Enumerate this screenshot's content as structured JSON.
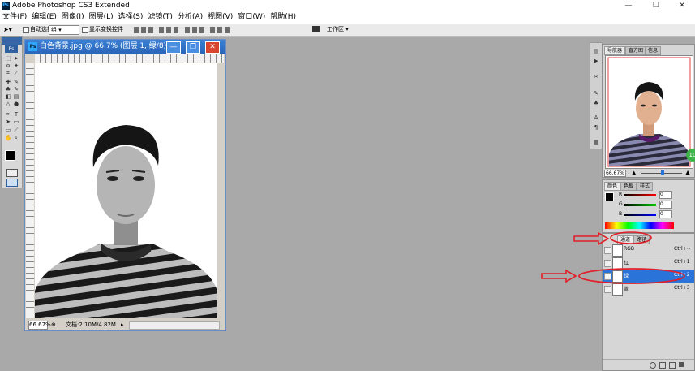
{
  "app": {
    "title": "Adobe Photoshop CS3 Extended",
    "logo": "Ps"
  },
  "window_controls": {
    "minimize": "—",
    "maximize": "❐",
    "close": "✕"
  },
  "menu": [
    "文件(F)",
    "编辑(E)",
    "图像(I)",
    "图层(L)",
    "选择(S)",
    "滤镜(T)",
    "分析(A)",
    "视图(V)",
    "窗口(W)",
    "帮助(H)"
  ],
  "options": {
    "auto_select_label": "自动选择",
    "auto_select_value": "组",
    "show_transform_label": "显示变换控件",
    "workspace_label": "工作区 ▾"
  },
  "toolbox": {
    "logo": "Ps"
  },
  "document": {
    "title": "白色背景.jpg @ 66.7% (图层 1, 绿/8)",
    "zoom": "66.67%",
    "doc_info": "文档:2.10M/4.82M"
  },
  "navigator": {
    "tabs": [
      "导航器",
      "直方图",
      "信息"
    ],
    "zoom": "66.67%",
    "badge": "10"
  },
  "color_panel": {
    "tabs": [
      "颜色",
      "色板",
      "样式"
    ],
    "sliders": [
      {
        "label": "R",
        "value": "0"
      },
      {
        "label": "G",
        "value": "0"
      },
      {
        "label": "B",
        "value": "0"
      }
    ]
  },
  "channels_panel": {
    "tabs": [
      "通道",
      "路径"
    ],
    "rows": [
      {
        "name": "RGB",
        "shortcut": "Ctrl+~",
        "selected": false
      },
      {
        "name": "红",
        "shortcut": "Ctrl+1",
        "selected": false
      },
      {
        "name": "绿",
        "shortcut": "Ctrl+2",
        "selected": true
      },
      {
        "name": "蓝",
        "shortcut": "Ctrl+3",
        "selected": false
      }
    ]
  },
  "colors": {
    "accent": "#2a73d9",
    "annotation_red": "#e0202a",
    "canvas_bg": "#a9a9a9"
  },
  "annotations": {
    "arrow_icon": "red-arrow-icon",
    "ellipse_icon": "red-ellipse-icon"
  }
}
